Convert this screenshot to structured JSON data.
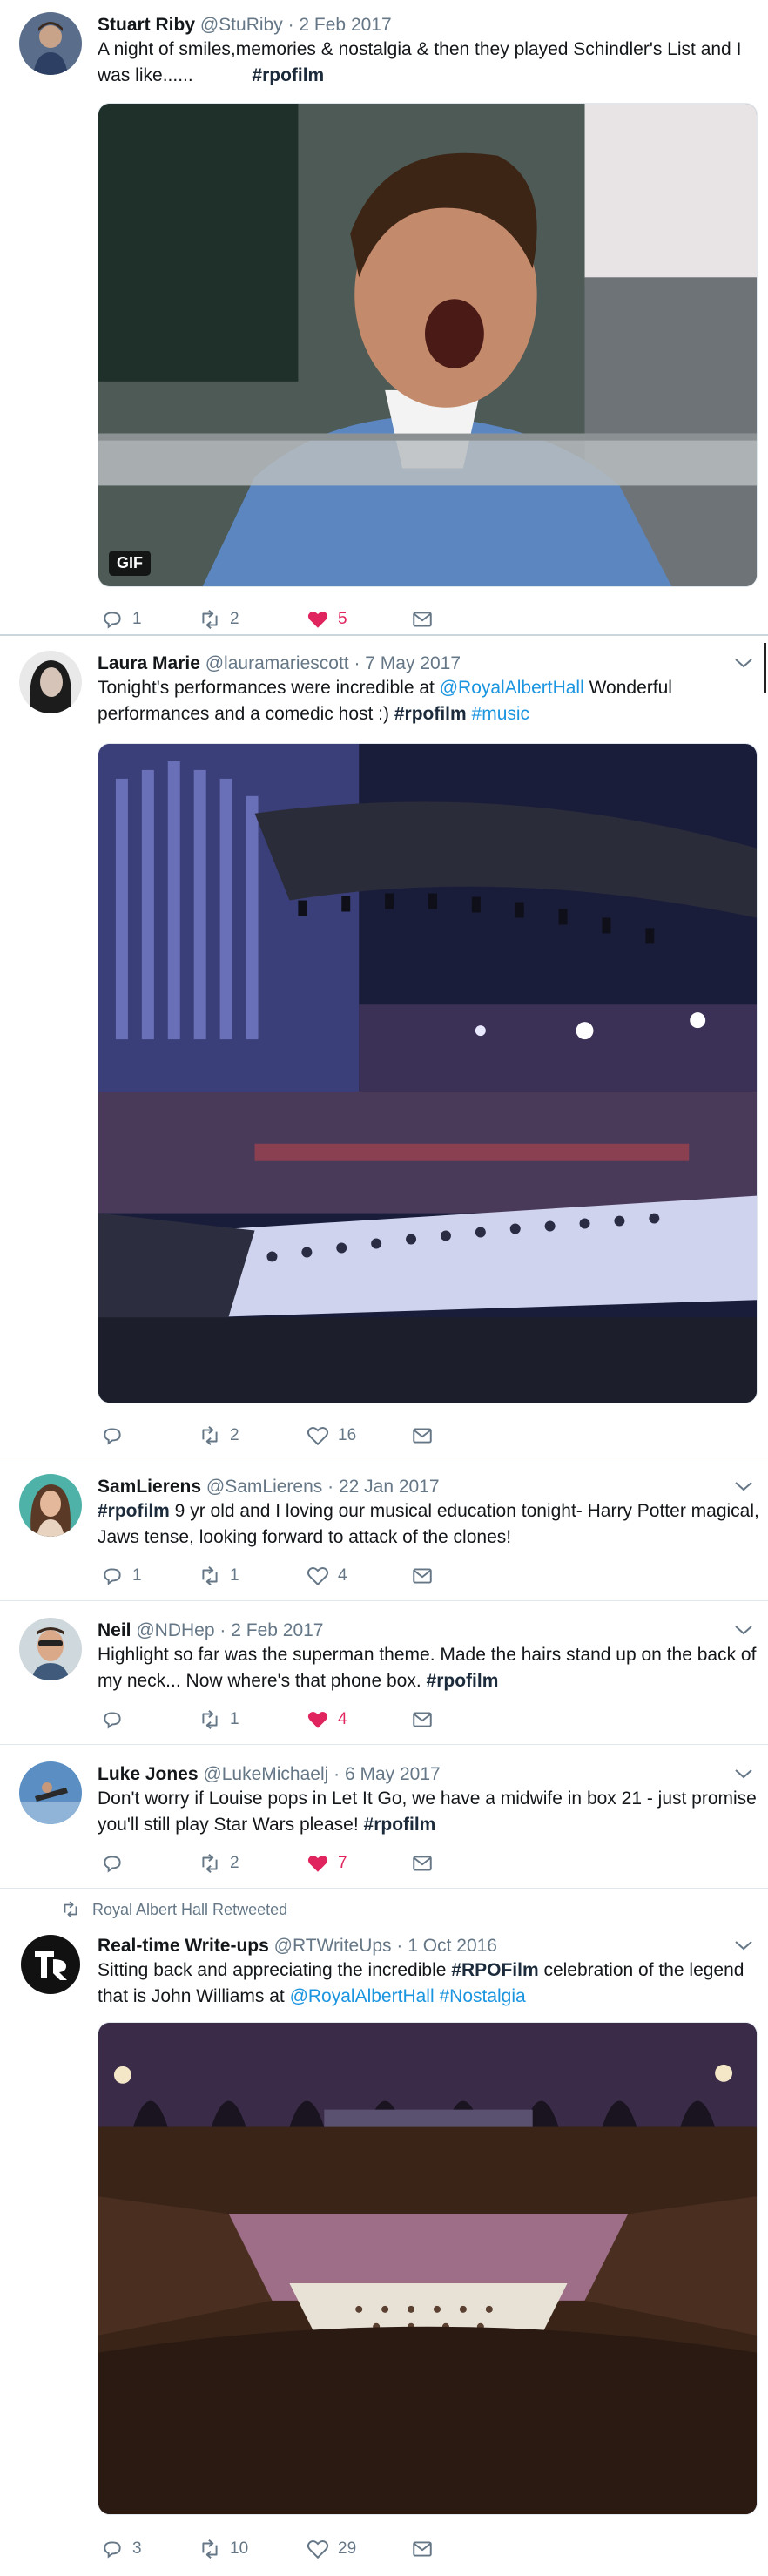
{
  "colors": {
    "accent": "#1b95e0",
    "like": "#e0245e",
    "muted": "#657786",
    "divider": "#e1e8ed"
  },
  "tweets": [
    {
      "name": "Stuart Riby",
      "handle": "@StuRiby",
      "sep": "·",
      "date": "2 Feb 2017",
      "text": "A night of smiles,memories & nostalgia & then they played Schindler's List and I was like......",
      "hashtag": "#rpofilm",
      "media_badge": "GIF",
      "replies": "1",
      "retweets": "2",
      "likes": "5",
      "liked": true
    },
    {
      "name": "Laura Marie",
      "handle": "@lauramariescott",
      "sep": "·",
      "date": "7 May 2017",
      "text_a": "Tonight's performances were incredible at ",
      "mention": "@RoyalAlbertHall",
      "text_b": " Wonderful performances and a comedic host :) ",
      "hashtag1": "#rpofilm",
      "hashtag2": "#music",
      "replies": "",
      "retweets": "2",
      "likes": "16",
      "liked": false
    },
    {
      "name": "SamLierens",
      "handle": "@SamLierens",
      "sep": "·",
      "date": "22 Jan 2017",
      "hashtag": "#rpofilm",
      "text": " 9 yr old and I loving our musical education tonight- Harry Potter magical, Jaws tense, looking forward to attack of the clones!",
      "replies": "1",
      "retweets": "1",
      "likes": "4",
      "liked": false
    },
    {
      "name": "Neil",
      "handle": "@NDHep",
      "sep": "·",
      "date": "2 Feb 2017",
      "text": "Highlight so far was the superman theme. Made the hairs stand up on the back of my neck... Now where's that phone box. ",
      "hashtag": "#rpofilm",
      "replies": "",
      "retweets": "1",
      "likes": "4",
      "liked": true
    },
    {
      "name": "Luke Jones",
      "handle": "@LukeMichaelj",
      "sep": "·",
      "date": "6 May 2017",
      "text": "Don't worry if Louise pops in Let It Go, we have a midwife in box 21 - just promise you'll still play Star Wars please! ",
      "hashtag": "#rpofilm",
      "replies": "",
      "retweets": "2",
      "likes": "7",
      "liked": true
    },
    {
      "retweet_context": "Royal Albert Hall Retweeted",
      "name": "Real-time Write-ups",
      "handle": "@RTWriteUps",
      "sep": "·",
      "date": "1 Oct 2016",
      "text_a": "Sitting back and appreciating the incredible ",
      "hashtag1": "#RPOFilm",
      "text_b": " celebration of the legend that is John Williams at ",
      "mention": "@RoyalAlbertHall",
      "text_c": " ",
      "hashtag2": "#Nostalgia",
      "replies": "3",
      "retweets": "10",
      "likes": "29",
      "liked": false
    }
  ]
}
